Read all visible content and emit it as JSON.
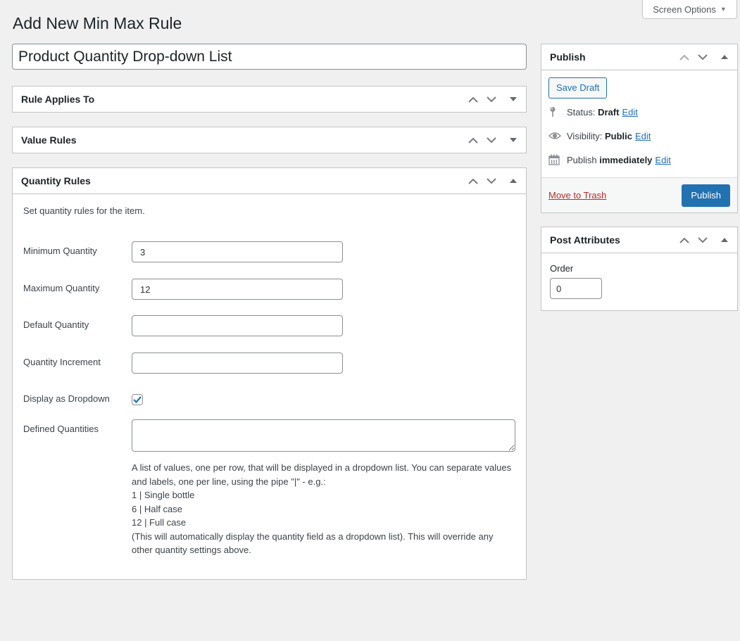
{
  "screen_options": {
    "label": "Screen Options",
    "icon": "caret-down-icon"
  },
  "page": {
    "title": "Add New Min Max Rule",
    "post_title_value": "Product Quantity Drop-down List"
  },
  "panels": {
    "rule_applies_to": {
      "title": "Rule Applies To",
      "expanded": false
    },
    "value_rules": {
      "title": "Value Rules",
      "expanded": false
    },
    "quantity_rules": {
      "title": "Quantity Rules",
      "expanded": true,
      "intro": "Set quantity rules for the item.",
      "fields": {
        "minimum_quantity": {
          "label": "Minimum Quantity",
          "value": "3"
        },
        "maximum_quantity": {
          "label": "Maximum Quantity",
          "value": "12"
        },
        "default_quantity": {
          "label": "Default Quantity",
          "value": ""
        },
        "quantity_increment": {
          "label": "Quantity Increment",
          "value": ""
        },
        "display_as_dropdown": {
          "label": "Display as Dropdown",
          "checked": true
        },
        "defined_quantities": {
          "label": "Defined Quantities",
          "value": ""
        }
      },
      "help_lines": [
        "A list of values, one per row, that will be displayed in a dropdown list. You can separate values",
        "and labels, one per line, using the pipe \"|\" - e.g.:",
        "1 | Single bottle",
        "6 | Half case",
        "12 | Full case",
        "(This will automatically display the quantity field as a dropdown list). This will override any",
        "other quantity settings above."
      ]
    }
  },
  "publish_box": {
    "title": "Publish",
    "save_draft_label": "Save Draft",
    "status_label": "Status:",
    "status_value": "Draft",
    "visibility_label": "Visibility:",
    "visibility_value": "Public",
    "publish_label": "Publish",
    "publish_value": "immediately",
    "edit_label": "Edit",
    "trash_label": "Move to Trash",
    "publish_button_label": "Publish"
  },
  "post_attributes": {
    "title": "Post Attributes",
    "order_label": "Order",
    "order_value": "0"
  },
  "colors": {
    "accent": "#2271b1",
    "danger": "#b32d2e",
    "background": "#f0f0f1",
    "border": "#c3c4c7"
  }
}
